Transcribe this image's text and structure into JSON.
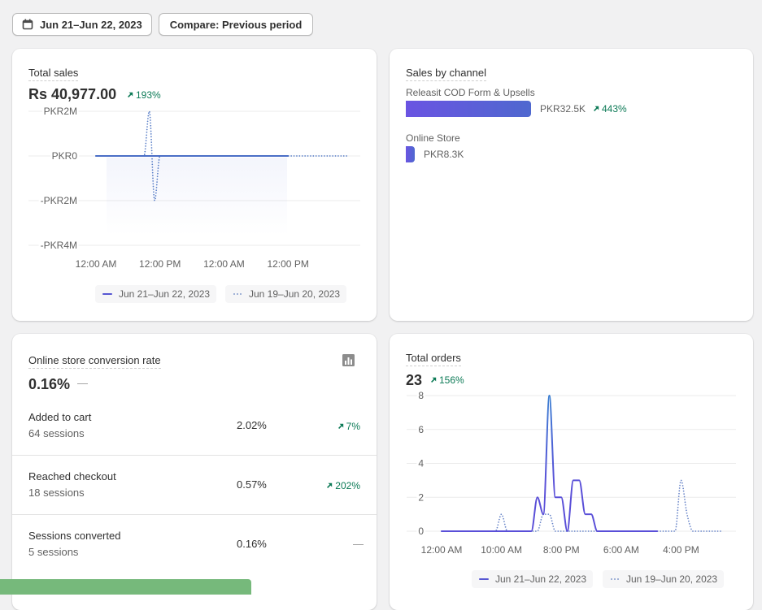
{
  "toolbar": {
    "date_range_label": "Jun 21–Jun 22, 2023",
    "compare_label": "Compare: Previous period"
  },
  "total_sales": {
    "title": "Total sales",
    "value": "Rs 40,977.00",
    "change": "193%",
    "change_direction": "up"
  },
  "sales_by_channel": {
    "title": "Sales by channel",
    "channels": [
      {
        "name": "Releasit COD Form & Upsells",
        "value": "PKR32.5K",
        "change": "443%",
        "change_direction": "up",
        "bar_ratio": 1.0
      },
      {
        "name": "Online Store",
        "value": "PKR8.3K",
        "change": null,
        "bar_ratio": 0.07
      }
    ]
  },
  "conversion": {
    "title": "Online store conversion rate",
    "value": "0.16%",
    "change": "—",
    "icon": "bar-chart-icon",
    "rows": [
      {
        "label": "Added to cart",
        "sessions": "64 sessions",
        "rate": "2.02%",
        "change": "7%",
        "direction": "up"
      },
      {
        "label": "Reached checkout",
        "sessions": "18 sessions",
        "rate": "0.57%",
        "change": "202%",
        "direction": "up"
      },
      {
        "label": "Sessions converted",
        "sessions": "5 sessions",
        "rate": "0.16%",
        "change": "—",
        "direction": "none"
      }
    ]
  },
  "total_orders": {
    "title": "Total orders",
    "value": "23",
    "change": "156%",
    "change_direction": "up"
  },
  "colors": {
    "positive": "#0c7a56",
    "channel_bar_start": "#6a54e2",
    "channel_bar_end": "#4f68cf",
    "bottom_bar": "#76b97b"
  },
  "chart_data": [
    {
      "id": "total_sales",
      "type": "line",
      "title": "Total sales",
      "xlabel": "",
      "ylabel": "",
      "x_unit": "hour",
      "xlim": [
        0,
        47
      ],
      "ylim": [
        -4000000,
        2000000
      ],
      "grid": true,
      "legend": "bottom",
      "y_ticks": [
        {
          "value": 2000000,
          "label": "PKR2M"
        },
        {
          "value": 0,
          "label": "PKR0"
        },
        {
          "value": -2000000,
          "label": "-PKR2M"
        },
        {
          "value": -4000000,
          "label": "-PKR4M"
        }
      ],
      "x_ticks": [
        {
          "x": 0,
          "label": "12:00 AM"
        },
        {
          "x": 12,
          "label": "12:00 PM"
        },
        {
          "x": 24,
          "label": "12:00 AM"
        },
        {
          "x": 36,
          "label": "12:00 PM"
        }
      ],
      "series": [
        {
          "name": "Jun 21–Jun 22, 2023",
          "style": "solid",
          "color": "#4a6ec6",
          "values": [
            0,
            0,
            0,
            0,
            0,
            0,
            0,
            0,
            0,
            0,
            0,
            0,
            0,
            0,
            0,
            0,
            0,
            0,
            0,
            0,
            0,
            0,
            0,
            0,
            0,
            0,
            0,
            0,
            0,
            0,
            0,
            0,
            0,
            0,
            0,
            0,
            0
          ]
        },
        {
          "name": "Jun 19–Jun 20, 2023",
          "style": "dotted",
          "color": "#5a7fc8",
          "values": [
            0,
            0,
            0,
            0,
            0,
            0,
            0,
            0,
            0,
            0,
            2000000,
            -2000000,
            0,
            0,
            0,
            0,
            0,
            0,
            0,
            0,
            0,
            0,
            0,
            0,
            0,
            0,
            0,
            0,
            0,
            0,
            0,
            0,
            0,
            0,
            0,
            0,
            0,
            0,
            0,
            0,
            0,
            0,
            0,
            0,
            0,
            0,
            0,
            0
          ]
        }
      ]
    },
    {
      "id": "total_orders",
      "type": "line",
      "title": "Total orders",
      "xlabel": "",
      "ylabel": "",
      "x_unit": "hour",
      "xlim": [
        0,
        47
      ],
      "ylim": [
        0,
        8
      ],
      "grid": true,
      "legend": "bottom",
      "y_ticks": [
        {
          "value": 8,
          "label": "8"
        },
        {
          "value": 6,
          "label": "6"
        },
        {
          "value": 4,
          "label": "4"
        },
        {
          "value": 2,
          "label": "2"
        },
        {
          "value": 0,
          "label": "0"
        }
      ],
      "x_ticks": [
        {
          "x": 0,
          "label": "12:00 AM"
        },
        {
          "x": 10,
          "label": "10:00 AM"
        },
        {
          "x": 20,
          "label": "8:00 PM"
        },
        {
          "x": 30,
          "label": "6:00 AM"
        },
        {
          "x": 40,
          "label": "4:00 PM"
        }
      ],
      "series": [
        {
          "name": "Jun 21–Jun 22, 2023",
          "style": "solid",
          "color": "#5a4fd8",
          "color_peak": "#3b7fd2",
          "values": [
            0,
            0,
            0,
            0,
            0,
            0,
            0,
            0,
            0,
            0,
            0,
            0,
            0,
            0,
            0,
            0,
            2,
            1,
            8,
            2,
            2,
            0,
            3,
            3,
            1,
            1,
            0,
            0,
            0,
            0,
            0,
            0,
            0,
            0,
            0,
            0,
            0
          ]
        },
        {
          "name": "Jun 19–Jun 20, 2023",
          "style": "dotted",
          "color": "#6a86c9",
          "values": [
            0,
            0,
            0,
            0,
            0,
            0,
            0,
            0,
            0,
            0,
            1,
            0,
            0,
            0,
            0,
            0,
            0,
            1,
            1,
            0,
            0,
            0,
            0,
            0,
            0,
            0,
            0,
            0,
            0,
            0,
            0,
            0,
            0,
            0,
            0,
            0,
            0,
            0,
            0,
            0,
            3,
            1,
            0,
            0,
            0,
            0,
            0,
            0
          ]
        }
      ]
    }
  ]
}
